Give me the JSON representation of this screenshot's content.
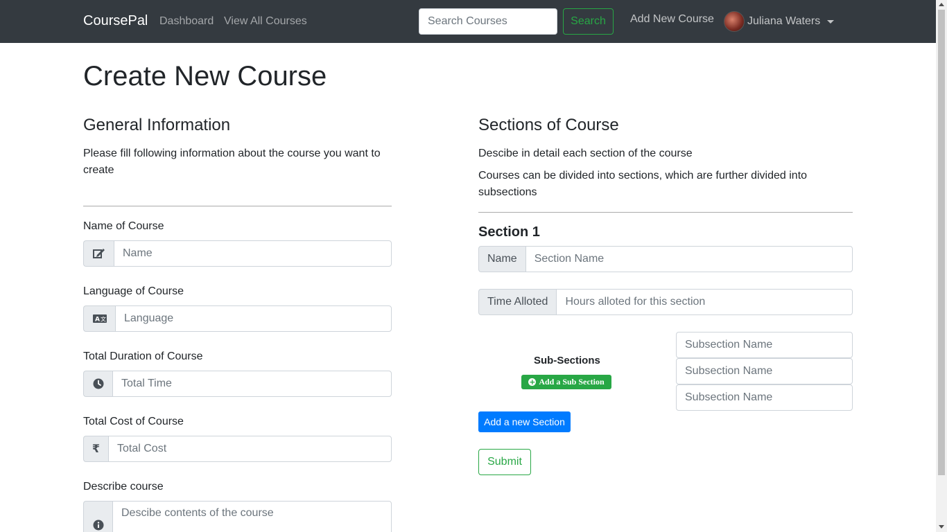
{
  "navbar": {
    "brand": "CoursePal",
    "links": [
      "Dashboard",
      "View All Courses"
    ],
    "search_placeholder": "Search Courses",
    "search_button": "Search",
    "add_course": "Add New Course",
    "user_name": "Juliana Waters"
  },
  "page": {
    "title": "Create New Course"
  },
  "general": {
    "heading": "General Information",
    "description": "Please fill following information about the course you want to create",
    "fields": [
      {
        "label": "Name of Course",
        "icon": "edit-icon",
        "placeholder": "Name"
      },
      {
        "label": "Language of Course",
        "icon": "language-icon",
        "placeholder": "Language"
      },
      {
        "label": "Total Duration of Course",
        "icon": "clock-icon",
        "placeholder": "Total Time"
      },
      {
        "label": "Total Cost of Course",
        "icon": "rupee-icon",
        "placeholder": "Total Cost",
        "icon_text": "₹"
      },
      {
        "label": "Describe course",
        "icon": "info-icon",
        "placeholder": "Descibe contents of the course"
      }
    ]
  },
  "sections": {
    "heading": "Sections of Course",
    "desc1": "Descibe in detail each section of the course",
    "desc2": "Courses can be divided into sections, which are further divided into subsections",
    "section_title": "Section 1",
    "name_label": "Name",
    "name_placeholder": "Section Name",
    "time_label": "Time Alloted",
    "time_placeholder": "Hours alloted for this section",
    "subsections_label": "Sub-Sections",
    "add_sub_button": "Add a Sub Section",
    "subsection_placeholders": [
      "Subsection Name",
      "Subsection Name",
      "Subsection Name"
    ],
    "add_section_button": "Add a new Section",
    "submit_button": "Submit"
  },
  "colors": {
    "navbar": "#343a40",
    "success": "#28a745",
    "primary": "#007bff"
  }
}
